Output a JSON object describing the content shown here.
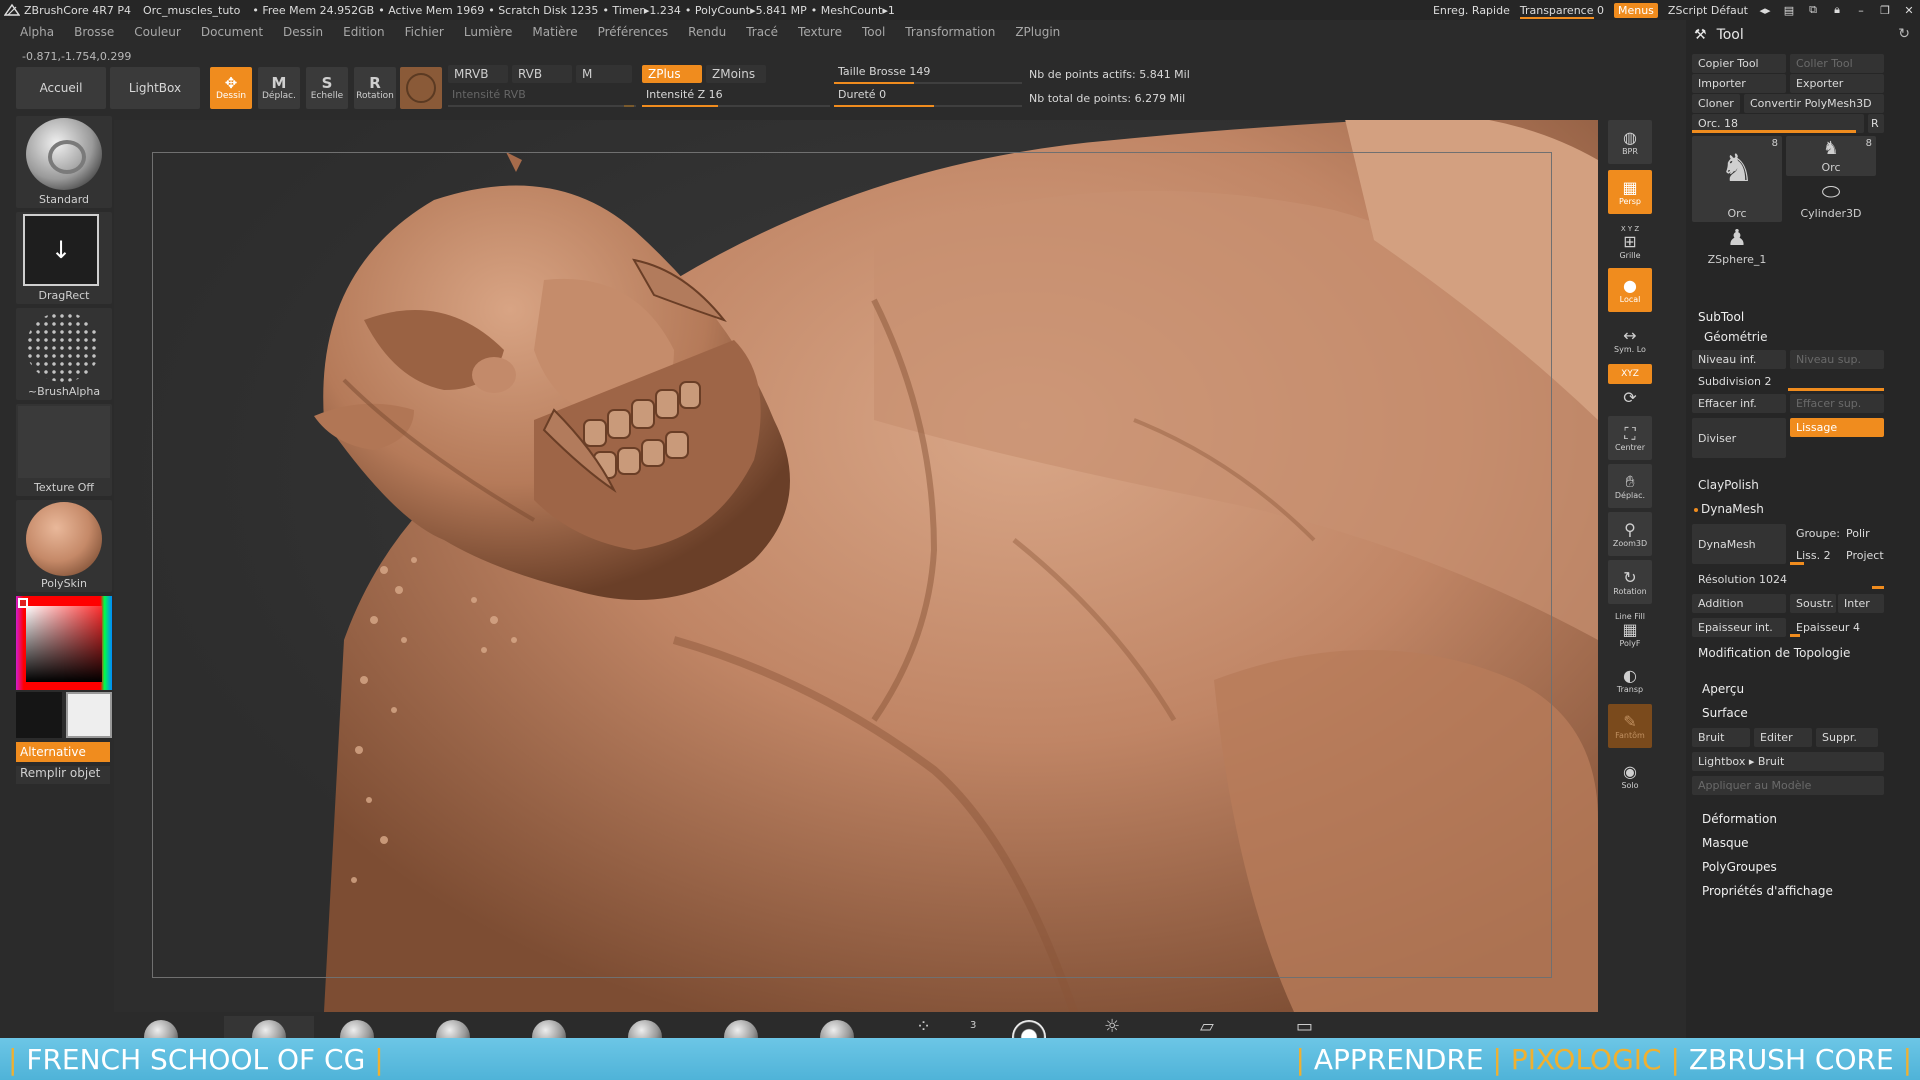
{
  "titlebar": {
    "app": "ZBrushCore 4R7 P4",
    "file": "Orc_muscles_tuto",
    "free_mem": "• Free Mem 24.952GB",
    "active_mem": "• Active Mem 1969",
    "scratch": "• Scratch Disk 1235",
    "timer": "• Timer▸1.234",
    "polycount": "• PolyCount▸5.841 MP",
    "meshcount": "• MeshCount▸1",
    "quicksave": "Enreg. Rapide",
    "transparency": "Transparence 0",
    "menus": "Menus",
    "zscript": "ZScript Défaut"
  },
  "menubar": [
    "Alpha",
    "Brosse",
    "Couleur",
    "Document",
    "Dessin",
    "Edition",
    "Fichier",
    "Lumière",
    "Matière",
    "Préférences",
    "Rendu",
    "Tracé",
    "Texture",
    "Tool",
    "Transformation",
    "ZPlugin"
  ],
  "coords": "-0.871,-1.754,0.299",
  "toolbar": {
    "home": "Accueil",
    "lightbox": "LightBox",
    "draw": "Dessin",
    "move": "Déplac.",
    "scale": "Echelle",
    "rotate": "Rotation",
    "mrgb": "MRVB",
    "rgb": "RVB",
    "m": "M",
    "rgb_intensity": "Intensité RVB",
    "zadd": "ZPlus",
    "zsub": "ZMoins",
    "z_intensity": "Intensité Z 16",
    "brush_size": "Taille Brosse 149",
    "hardness": "Dureté 0",
    "active_points": "Nb de points actifs: 5.841 Mil",
    "total_points": "Nb total de points: 6.279 Mil"
  },
  "leftshelf": {
    "brush": "Standard",
    "stroke": "DragRect",
    "alpha": "~BrushAlpha",
    "texture": "Texture Off",
    "material": "PolySkin",
    "alternate": "Alternative",
    "fill_object": "Remplir objet"
  },
  "rightshelf": {
    "bpr": "BPR",
    "persp": "Persp",
    "floor_axes": "X Y Z",
    "floor": "Grille",
    "local": "Local",
    "symlo": "Sym. Lo",
    "xyz": "XYZ",
    "frame": "Centrer",
    "move": "Déplac.",
    "zoom": "Zoom3D",
    "rotate": "Rotation",
    "linefill": "Line Fill",
    "polyf": "PolyF",
    "transp": "Transp",
    "ghost": "Fantôm",
    "solo": "Solo"
  },
  "toolpanel": {
    "title": "Tool",
    "copy_tool": "Copier Tool",
    "paste_tool": "Coller Tool",
    "import": "Importer",
    "export": "Exporter",
    "clone": "Cloner",
    "make_polymesh": "Convertir PolyMesh3D",
    "current_tool": "Orc. 18",
    "r": "R",
    "thumbs": [
      {
        "name": "Orc",
        "count": "8"
      },
      {
        "name": "Orc",
        "count": "8"
      },
      {
        "name": "Cylinder3D",
        "count": ""
      },
      {
        "name": "ZSphere_1",
        "count": ""
      }
    ],
    "subtool": "SubTool",
    "geometry": "Géométrie",
    "lower_res": "Niveau inf.",
    "higher_res": "Niveau sup.",
    "sdiv": "Subdivision 2",
    "del_lower": "Effacer inf.",
    "del_higher": "Effacer sup.",
    "divide": "Diviser",
    "smooth": "Lissage",
    "claypolish": "ClayPolish",
    "dynamesh_section": "DynaMesh",
    "dynamesh_btn": "DynaMesh",
    "groups": "Groupe:",
    "polish": "Polir",
    "blur": "Liss. 2",
    "project": "Project",
    "resolution": "Résolution 1024",
    "add": "Addition",
    "sub": "Soustr.",
    "and": "Inter",
    "thick_int": "Epaisseur int.",
    "thick": "Epaisseur 4",
    "topology": "Modification de Topologie",
    "preview": "Aperçu",
    "surface": "Surface",
    "noise": "Bruit",
    "edit": "Editer",
    "delete": "Suppr.",
    "lightbox_noise": "Lightbox ▸ Bruit",
    "apply_model": "Appliquer au Modèle",
    "deformation": "Déformation",
    "masking": "Masque",
    "polygroups": "PolyGroupes",
    "display_props": "Propriétés d'affichage"
  },
  "bottomshelf": {
    "count": "3"
  },
  "banner": {
    "left_text": "FRENCH SCHOOL OF CG",
    "right_a": "APPRENDRE",
    "right_b": "PIXOLOGIC",
    "right_c": "ZBRUSH CORE"
  },
  "colors": {
    "accent": "#f08c1e",
    "panel": "#262626",
    "skin": "#c6906c",
    "banner": "#5ab9dc"
  }
}
